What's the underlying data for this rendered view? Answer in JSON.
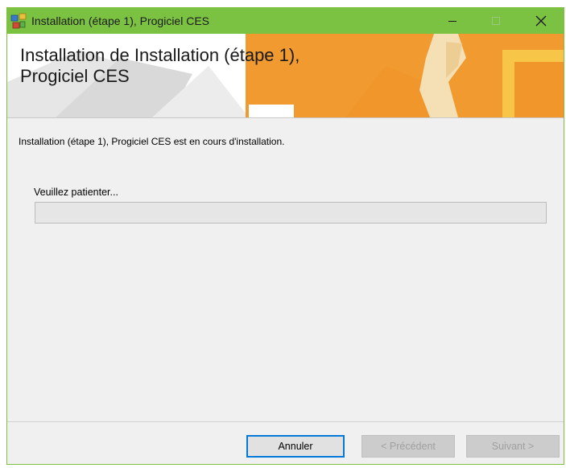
{
  "window": {
    "title": "Installation (étape 1), Progiciel CES",
    "controls": {
      "minimize_icon": "minimize-icon",
      "maximize_icon": "maximize-icon",
      "close_icon": "close-icon"
    }
  },
  "banner": {
    "title_line1": "Installation de Installation (étape 1),",
    "title_line2": "Progiciel CES"
  },
  "main": {
    "status_text": "Installation (étape 1), Progiciel CES est en cours d'installation.",
    "wait_label": "Veuillez patienter...",
    "progress": 0
  },
  "footer": {
    "cancel_label": "Annuler",
    "previous_label": "< Précédent",
    "next_label": "Suivant >"
  },
  "colors": {
    "titlebar": "#7cc242",
    "banner_orange": "#f0962a",
    "focus_border": "#0078d7"
  }
}
